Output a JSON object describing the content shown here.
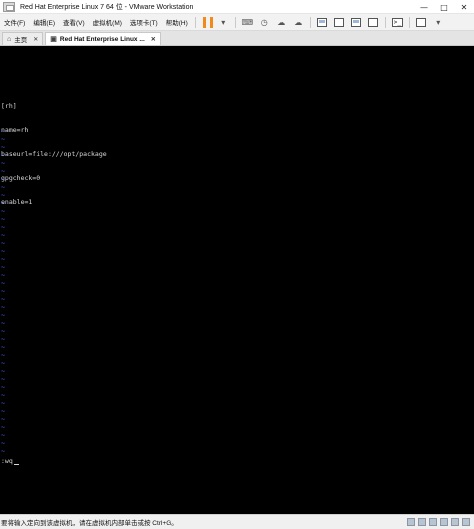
{
  "window": {
    "title": "Red Hat Enterprise Linux 7 64 位 - VMware Workstation"
  },
  "menu": {
    "items": [
      "文件(F)",
      "编辑(E)",
      "查看(V)",
      "虚拟机(M)",
      "选项卡(T)",
      "帮助(H)"
    ]
  },
  "tabs": [
    {
      "label": "主页"
    },
    {
      "label": "Red Hat Enterprise Linux ..."
    }
  ],
  "console": {
    "lines": [
      "[rh]",
      "name=rh",
      "baseurl=file:///opt/package",
      "gpgcheck=0",
      "enable=1"
    ],
    "empty_line_marker": "~",
    "command_line": ":wq"
  },
  "status": {
    "text": "要将输入定向到该虚拟机，请在虚拟机内部单击或按 Ctrl+G。"
  },
  "colors": {
    "console_bg": "#000000",
    "console_text": "#d8d8d8",
    "tilde": "#4a6cff",
    "pause_accent": "#f28a1a"
  }
}
